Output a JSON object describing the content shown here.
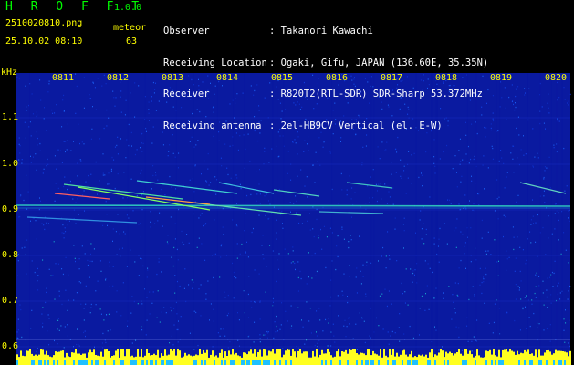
{
  "header": {
    "app_title": "H R O F F T",
    "app_version": "1.0.0",
    "file_name": "2510020810.png",
    "timestamp": "25.10.02 08:10",
    "detect_label": "meteor",
    "detect_count": "63"
  },
  "info": [
    {
      "key": "Observer",
      "value": ": Takanori Kawachi"
    },
    {
      "key": "Receiving Location",
      "value": ": Ogaki, Gifu, JAPAN (136.60E, 35.35N)"
    },
    {
      "key": "Receiver",
      "value": ": R820T2(RTL-SDR) SDR-Sharp 53.372MHz"
    },
    {
      "key": "Receiving antenna",
      "value": ": 2el-HB9CV Vertical (el. E-W)"
    }
  ],
  "axis": {
    "unit": "kHz",
    "y_ticks": [
      "1.1",
      "1.0",
      "0.9",
      "0.8",
      "0.7",
      "0.6"
    ],
    "x_ticks": [
      "0811",
      "0812",
      "0813",
      "0814",
      "0815",
      "0816",
      "0817",
      "0818",
      "0819",
      "0820"
    ]
  },
  "colors": {
    "label_yellow": "#ffff00",
    "title_green": "#00ff00",
    "background": "#000000",
    "spectrum_base": "#0a1aa0"
  }
}
